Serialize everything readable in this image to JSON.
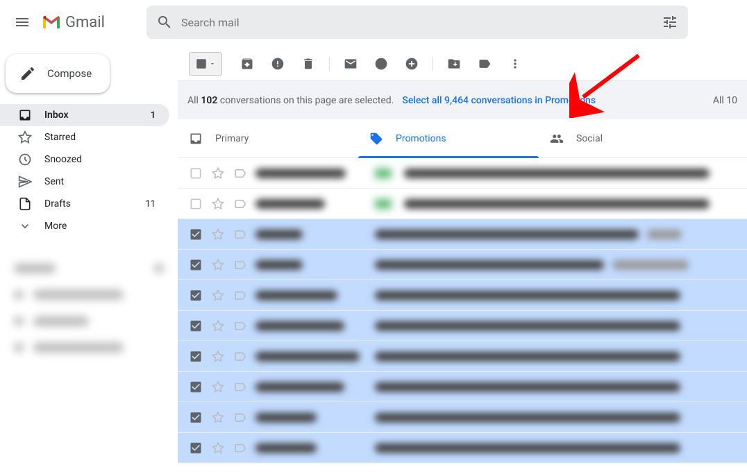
{
  "header": {
    "brand": "Gmail",
    "search_placeholder": "Search mail"
  },
  "sidebar": {
    "compose": "Compose",
    "items": [
      {
        "label": "Inbox",
        "count": "1",
        "active": true,
        "icon": "inbox"
      },
      {
        "label": "Starred",
        "count": "",
        "active": false,
        "icon": "star"
      },
      {
        "label": "Snoozed",
        "count": "",
        "active": false,
        "icon": "clock"
      },
      {
        "label": "Sent",
        "count": "",
        "active": false,
        "icon": "send"
      },
      {
        "label": "Drafts",
        "count": "11",
        "active": false,
        "icon": "draft"
      },
      {
        "label": "More",
        "count": "",
        "active": false,
        "icon": "more"
      }
    ]
  },
  "banner": {
    "all_prefix": "All ",
    "page_count": "102",
    "all_suffix": " conversations on this page are selected.",
    "link_prefix": "Select all ",
    "total_count": "9,464",
    "link_suffix": " conversations in Promotions",
    "right_text": "All 10"
  },
  "tabs": [
    {
      "label": "Primary",
      "icon": "inbox-tab",
      "active": false
    },
    {
      "label": "Promotions",
      "icon": "tag",
      "active": true
    },
    {
      "label": "Social",
      "icon": "people",
      "active": false
    }
  ],
  "mail": {
    "rows": [
      {
        "selected": false,
        "checked": false,
        "green": true,
        "senderW": 130,
        "subjW": 440,
        "extraW": 0
      },
      {
        "selected": false,
        "checked": false,
        "green": true,
        "senderW": 100,
        "subjW": 440,
        "extraW": 0
      },
      {
        "selected": true,
        "checked": true,
        "green": false,
        "senderW": 68,
        "subjW": 380,
        "extraW": 50
      },
      {
        "selected": true,
        "checked": true,
        "green": false,
        "senderW": 68,
        "subjW": 330,
        "extraW": 110
      },
      {
        "selected": true,
        "checked": true,
        "green": false,
        "senderW": 118,
        "subjW": 440,
        "extraW": 0
      },
      {
        "selected": true,
        "checked": true,
        "green": false,
        "senderW": 128,
        "subjW": 440,
        "extraW": 0
      },
      {
        "selected": true,
        "checked": true,
        "green": false,
        "senderW": 150,
        "subjW": 440,
        "extraW": 0
      },
      {
        "selected": true,
        "checked": true,
        "green": false,
        "senderW": 128,
        "subjW": 440,
        "extraW": 0
      },
      {
        "selected": true,
        "checked": true,
        "green": false,
        "senderW": 88,
        "subjW": 440,
        "extraW": 0
      },
      {
        "selected": true,
        "checked": true,
        "green": false,
        "senderW": 88,
        "subjW": 440,
        "extraW": 0
      }
    ]
  }
}
